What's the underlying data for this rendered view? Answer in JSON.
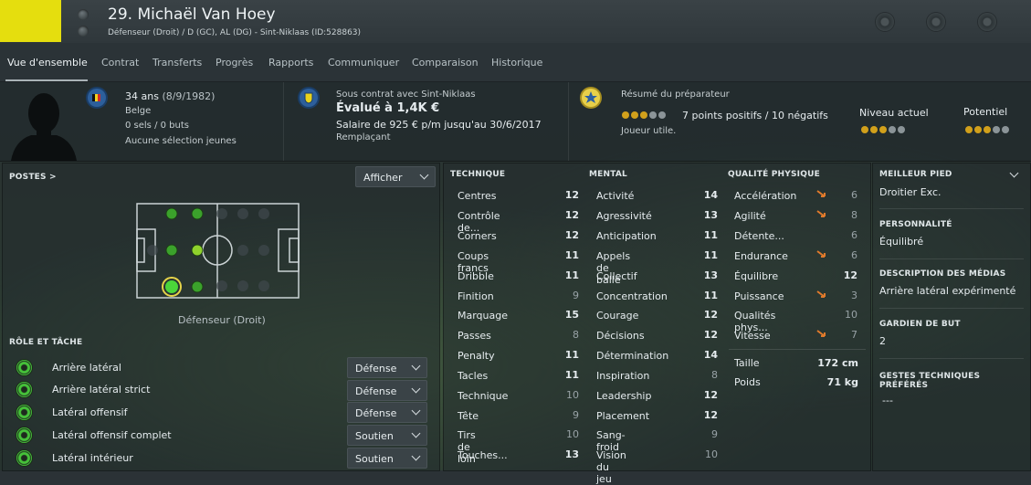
{
  "header": {
    "player_name": "29. Michaël Van Hoey",
    "player_sub": "Défenseur (Droit) / D (GC), AL (DG) - Sint-Niklaas (ID:528863)",
    "club_color": "#e5de0e"
  },
  "tabs": [
    "Vue d'ensemble",
    "Contrat",
    "Transferts",
    "Progrès",
    "Rapports",
    "Communiquer",
    "Comparaison",
    "Historique"
  ],
  "info": {
    "age": "34 ans",
    "birth": "(8/9/1982)",
    "nationality": "Belge",
    "caps": "0 sels / 0 buts",
    "youth": "Aucune sélection jeunes",
    "contract_label": "Sous contrat avec Sint-Niklaas",
    "value": "Évalué à 1,4K €",
    "salary": "Salaire de 925 € p/m jusqu'au 30/6/2017",
    "squad_status": "Remplaçant",
    "coach_title": "Résumé du préparateur",
    "coach_summary": "7 points positifs / 10 négatifs",
    "coach_verdict": "Joueur utile.",
    "current_ability_label": "Niveau actuel",
    "potential_ability_label": "Potentiel",
    "stars_current": 3,
    "stars_potential": 3,
    "stars_summary": 3
  },
  "positions": {
    "title": "POSTES >",
    "button": "Afficher",
    "caption": "Défenseur (Droit)"
  },
  "roles": {
    "title": "RÔLE ET TÂCHE",
    "items": [
      {
        "name": "Arrière latéral",
        "duty": "Défense"
      },
      {
        "name": "Arrière latéral strict",
        "duty": "Défense"
      },
      {
        "name": "Latéral offensif",
        "duty": "Défense"
      },
      {
        "name": "Latéral offensif complet",
        "duty": "Soutien"
      },
      {
        "name": "Latéral intérieur",
        "duty": "Soutien"
      }
    ]
  },
  "attributes": {
    "technical_title": "TECHNIQUE",
    "mental_title": "MENTAL",
    "physical_title": "QUALITÉ PHYSIQUE",
    "technical": [
      {
        "name": "Centres",
        "value": "12"
      },
      {
        "name": "Contrôle de...",
        "value": "12"
      },
      {
        "name": "Corners",
        "value": "12"
      },
      {
        "name": "Coups francs",
        "value": "11"
      },
      {
        "name": "Dribble",
        "value": "11"
      },
      {
        "name": "Finition",
        "value": "9"
      },
      {
        "name": "Marquage",
        "value": "15"
      },
      {
        "name": "Passes",
        "value": "8"
      },
      {
        "name": "Penalty",
        "value": "11"
      },
      {
        "name": "Tacles",
        "value": "11"
      },
      {
        "name": "Technique",
        "value": "10"
      },
      {
        "name": "Tête",
        "value": "9"
      },
      {
        "name": "Tirs de loin",
        "value": "10"
      },
      {
        "name": "Touches...",
        "value": "13"
      }
    ],
    "mental": [
      {
        "name": "Activité",
        "value": "14"
      },
      {
        "name": "Agressivité",
        "value": "13"
      },
      {
        "name": "Anticipation",
        "value": "11"
      },
      {
        "name": "Appels de balle",
        "value": "11"
      },
      {
        "name": "Collectif",
        "value": "13"
      },
      {
        "name": "Concentration",
        "value": "11"
      },
      {
        "name": "Courage",
        "value": "12"
      },
      {
        "name": "Décisions",
        "value": "12"
      },
      {
        "name": "Détermination",
        "value": "14"
      },
      {
        "name": "Inspiration",
        "value": "8"
      },
      {
        "name": "Leadership",
        "value": "12"
      },
      {
        "name": "Placement",
        "value": "12"
      },
      {
        "name": "Sang-froid",
        "value": "9"
      },
      {
        "name": "Vision du jeu",
        "value": "10"
      }
    ],
    "physical": [
      {
        "name": "Accélération",
        "value": "6",
        "trend": "down"
      },
      {
        "name": "Agilité",
        "value": "8",
        "trend": "down"
      },
      {
        "name": "Détente...",
        "value": "6",
        "trend": ""
      },
      {
        "name": "Endurance",
        "value": "6",
        "trend": "down"
      },
      {
        "name": "Équilibre",
        "value": "12",
        "trend": ""
      },
      {
        "name": "Puissance",
        "value": "3",
        "trend": "down"
      },
      {
        "name": "Qualités phys...",
        "value": "10",
        "trend": ""
      },
      {
        "name": "Vitesse",
        "value": "7",
        "trend": "down"
      }
    ],
    "height_label": "Taille",
    "height": "172 cm",
    "weight_label": "Poids",
    "weight": "71 kg"
  },
  "side": {
    "foot_title": "MEILLEUR PIED",
    "foot": "Droitier Exc.",
    "personality_title": "PERSONNALITÉ",
    "personality": "Équilibré",
    "media_title": "DESCRIPTION DES MÉDIAS",
    "media": "Arrière latéral expérimenté",
    "gk_title": "GARDIEN DE BUT",
    "gk": "2",
    "ppm_title": "GESTES TECHNIQUES PRÉFÉRÉS",
    "ppm": "---"
  }
}
